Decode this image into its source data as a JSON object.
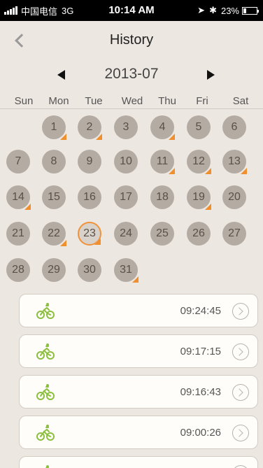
{
  "status_bar": {
    "carrier": "中国电信",
    "network": "3G",
    "time": "10:14 AM",
    "battery": "23%",
    "battery_level": 0.23
  },
  "nav": {
    "title": "History",
    "back_icon": "chevron-left-icon"
  },
  "calendar": {
    "month": "2013-07",
    "weekdays": [
      "Sun",
      "Mon",
      "Tue",
      "Wed",
      "Thu",
      "Fri",
      "Sat"
    ],
    "start_weekday": 1,
    "days_in_month": 31,
    "selected_day": 23,
    "marked_days": [
      1,
      2,
      4,
      11,
      12,
      13,
      14,
      19,
      22,
      23,
      31
    ],
    "colors": {
      "day_fill": "#b4aba3",
      "marker": "#ef8f2e",
      "selected_border": "#f0923a"
    }
  },
  "history": {
    "items": [
      {
        "icon": "bicycle-icon",
        "time": "09:24:45"
      },
      {
        "icon": "bicycle-icon",
        "time": "09:17:15"
      },
      {
        "icon": "bicycle-icon",
        "time": "09:16:43"
      },
      {
        "icon": "bicycle-icon",
        "time": "09:00:26"
      },
      {
        "icon": "bicycle-icon",
        "time": ""
      }
    ]
  }
}
